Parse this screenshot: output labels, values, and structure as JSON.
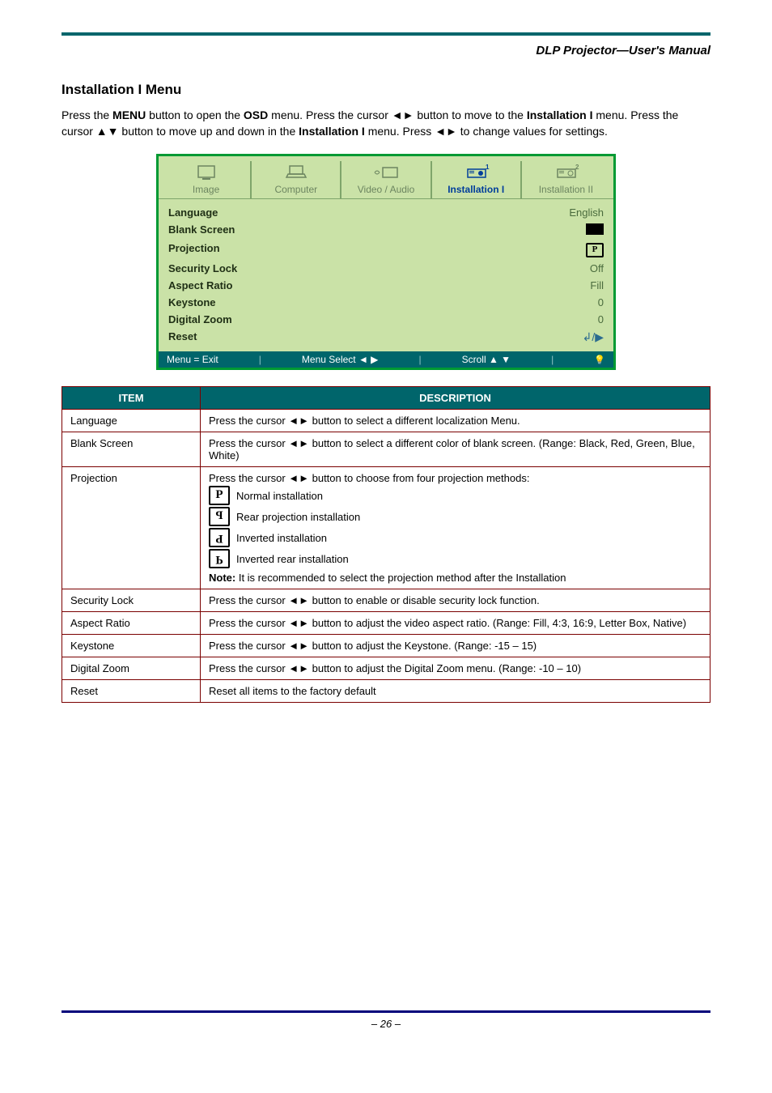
{
  "header": {
    "title": "DLP Projector—User's Manual"
  },
  "section": {
    "title": "Installation I Menu",
    "desc_pre": "Press the ",
    "desc_menu": "MENU",
    "desc_mid1": " button to open the ",
    "desc_osd": "OSD",
    "desc_mid2": " menu. Press the cursor ",
    "desc_lr": "◄►",
    "desc_mid3": " button to move to the ",
    "desc_tabname": "Installation I",
    "desc_mid4": " menu. Press the cursor ",
    "desc_ud": "▲▼",
    "desc_mid5": " button to move up and down in the ",
    "desc_tabname2": "Installation I",
    "desc_mid6": " menu. Press ",
    "desc_lr2": "◄►",
    "desc_end": " to change values for settings."
  },
  "osd": {
    "tabs": [
      "Image",
      "Computer",
      "Video / Audio",
      "Installation I",
      "Installation II"
    ],
    "active_tab_index": 3,
    "items": [
      {
        "label": "Language",
        "value": "English"
      },
      {
        "label": "Blank Screen",
        "value_type": "swatch"
      },
      {
        "label": "Projection",
        "value_type": "proj_icon"
      },
      {
        "label": "Security Lock",
        "value": "Off"
      },
      {
        "label": "Aspect Ratio",
        "value": "Fill"
      },
      {
        "label": "Keystone",
        "value": "0"
      },
      {
        "label": "Digital Zoom",
        "value": "0"
      },
      {
        "label": "Reset",
        "value_type": "enter"
      }
    ],
    "footer": {
      "exit": "Menu = Exit",
      "select": "Menu Select ◄ ▶",
      "scroll": "Scroll ▲ ▼"
    }
  },
  "table": {
    "headers": [
      "ITEM",
      "DESCRIPTION"
    ],
    "rows": [
      {
        "item": "Language",
        "desc_pre": "Press the cursor ",
        "desc_arrows": "◄►",
        "desc_post": " button to select a different localization Menu."
      },
      {
        "item": "Blank Screen",
        "desc_pre": "Press the cursor ",
        "desc_arrows": "◄►",
        "desc_post": " button to select a different color of blank screen. (Range: Black, Red, Green, Blue, White)"
      },
      {
        "item": "Projection",
        "desc_pre": "Press the cursor ",
        "desc_arrows": "◄►",
        "desc_post": " button to choose from four projection methods:",
        "options": [
          "Normal installation",
          "Rear projection installation",
          "Inverted installation",
          "Inverted rear installation"
        ],
        "note_pre": "Note:",
        "note": " It is recommended to select the projection method after the Installation"
      },
      {
        "item": "Security Lock",
        "desc_pre": "Press the cursor ",
        "desc_arrows": "◄►",
        "desc_post": " button to enable or disable security lock function."
      },
      {
        "item": "Aspect Ratio",
        "desc_pre": "Press the cursor ",
        "desc_arrows": "◄►",
        "desc_post": " button to adjust the video aspect ratio. (Range: Fill, 4:3, 16:9, Letter Box, Native)"
      },
      {
        "item": "Keystone",
        "desc_pre": "Press the cursor ",
        "desc_arrows": "◄►",
        "desc_post": " button to adjust the Keystone. (Range: -15 – 15)"
      },
      {
        "item": "Digital Zoom",
        "desc_pre": "Press the cursor ",
        "desc_arrows": "◄►",
        "desc_post": " button to adjust the Digital Zoom menu. (Range: -10 – 10)"
      },
      {
        "item": "Reset",
        "desc": "Reset all items to the factory default"
      }
    ]
  },
  "footer": {
    "page": "– 26 –"
  }
}
